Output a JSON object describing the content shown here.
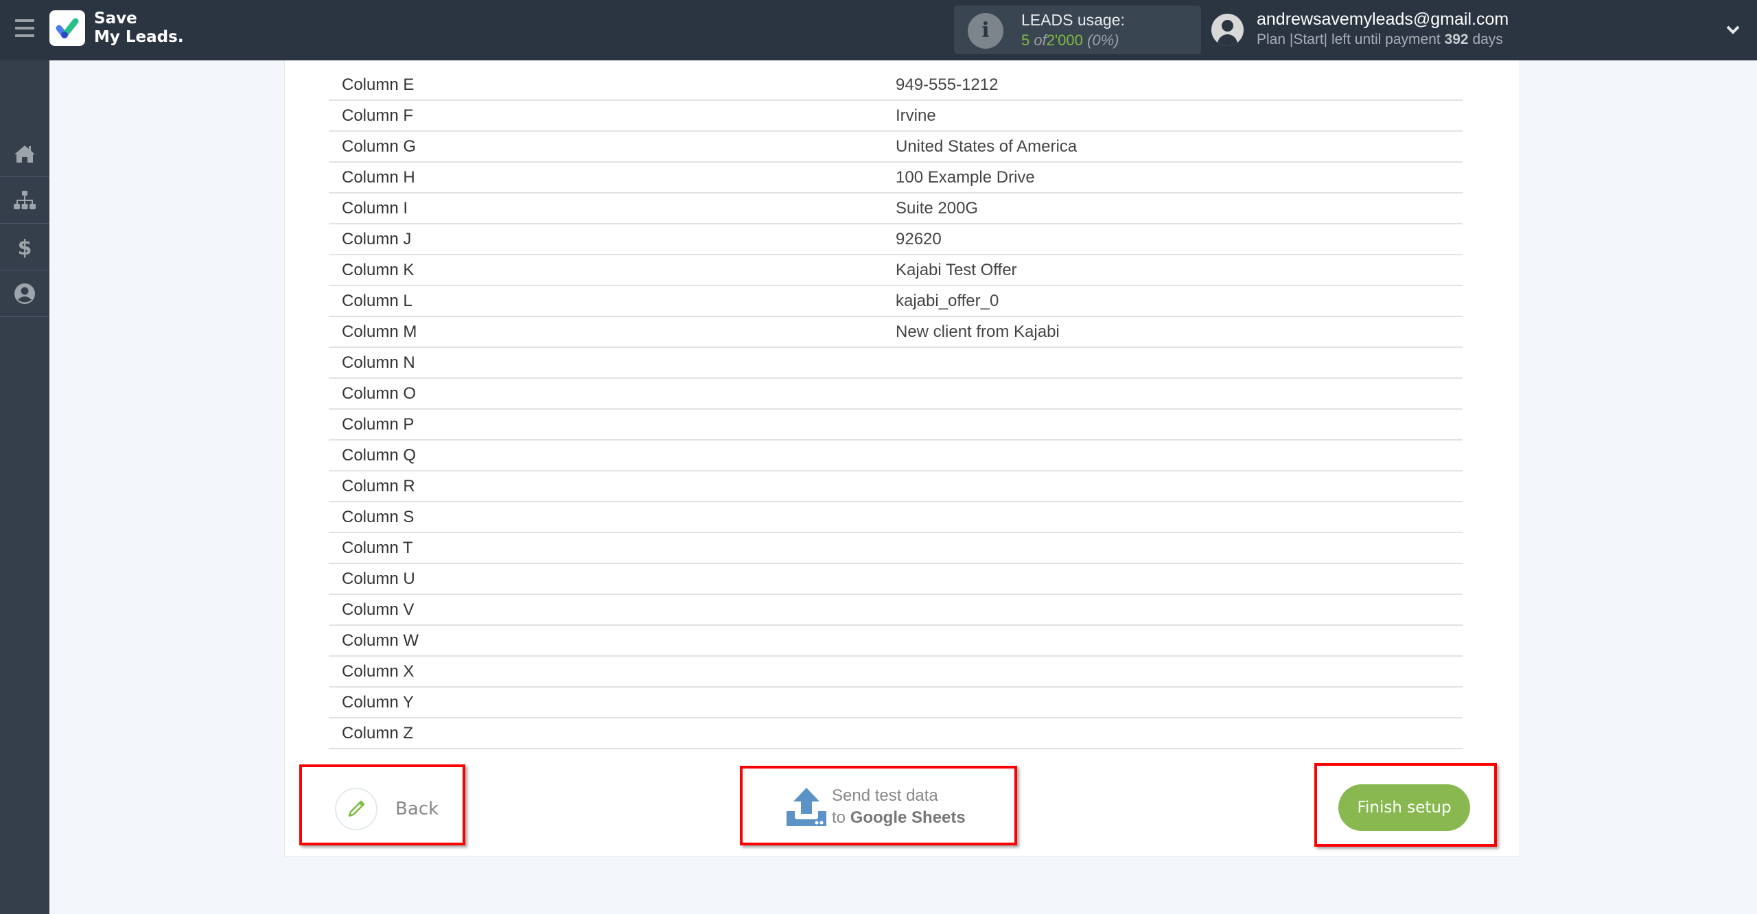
{
  "app": {
    "logo_line1": "Save",
    "logo_line2": "My Leads."
  },
  "usage": {
    "title": "LEADS usage:",
    "used": "5",
    "of": "of",
    "limit": "2'000",
    "percent": "(0%)",
    "icon": "info-icon"
  },
  "account": {
    "email": "andrewsavemyleads@gmail.com",
    "plan_prefix": "Plan |Start| left until payment",
    "days": "392",
    "days_suffix": "days"
  },
  "sidebar": {
    "items": [
      {
        "name": "home",
        "icon": "home-icon"
      },
      {
        "name": "connections",
        "icon": "sitemap-icon"
      },
      {
        "name": "billing",
        "icon": "dollar-icon"
      },
      {
        "name": "profile",
        "icon": "user-circle-icon"
      }
    ]
  },
  "table": {
    "rows": [
      {
        "column": "Column E",
        "value": "949-555-1212"
      },
      {
        "column": "Column F",
        "value": "Irvine"
      },
      {
        "column": "Column G",
        "value": "United States of America"
      },
      {
        "column": "Column H",
        "value": "100 Example Drive"
      },
      {
        "column": "Column I",
        "value": "Suite 200G"
      },
      {
        "column": "Column J",
        "value": "92620"
      },
      {
        "column": "Column K",
        "value": "Kajabi Test Offer"
      },
      {
        "column": "Column L",
        "value": "kajabi_offer_0"
      },
      {
        "column": "Column M",
        "value": "New client from Kajabi"
      },
      {
        "column": "Column N",
        "value": ""
      },
      {
        "column": "Column O",
        "value": ""
      },
      {
        "column": "Column P",
        "value": ""
      },
      {
        "column": "Column Q",
        "value": ""
      },
      {
        "column": "Column R",
        "value": ""
      },
      {
        "column": "Column S",
        "value": ""
      },
      {
        "column": "Column T",
        "value": ""
      },
      {
        "column": "Column U",
        "value": ""
      },
      {
        "column": "Column V",
        "value": ""
      },
      {
        "column": "Column W",
        "value": ""
      },
      {
        "column": "Column X",
        "value": ""
      },
      {
        "column": "Column Y",
        "value": ""
      },
      {
        "column": "Column Z",
        "value": ""
      }
    ]
  },
  "actions": {
    "back_label": "Back",
    "send_line1": "Send test data",
    "send_line2_prefix": "to",
    "send_line2_target": "Google Sheets",
    "finish_label": "Finish setup"
  },
  "colors": {
    "header_bg": "#2b3441",
    "sidebar_bg": "#353f4c",
    "accent_green": "#88b84f",
    "usage_green": "#7dbb3f",
    "highlight_red": "#ff0000",
    "upload_blue": "#5b93c7"
  }
}
